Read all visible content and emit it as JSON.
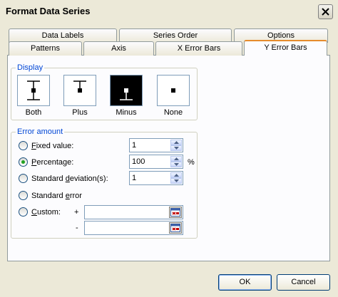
{
  "window": {
    "title": "Format Data Series"
  },
  "tabs": {
    "row_back": [
      "Data Labels",
      "Series Order",
      "Options"
    ],
    "row_front": [
      "Patterns",
      "Axis",
      "X Error Bars",
      "Y Error Bars"
    ],
    "active": "Y Error Bars"
  },
  "display": {
    "legend": "Display",
    "options": [
      {
        "label": "Both",
        "icon": "error-bar-both-icon",
        "selected": false
      },
      {
        "label": "Plus",
        "icon": "error-bar-plus-icon",
        "selected": false
      },
      {
        "label": "Minus",
        "icon": "error-bar-minus-icon",
        "selected": true
      },
      {
        "label": "None",
        "icon": "error-bar-none-icon",
        "selected": false
      }
    ]
  },
  "error_amount": {
    "legend": "Error amount",
    "fixed_value": {
      "label_key": "F",
      "label_rest": "ixed value:",
      "value": "1",
      "checked": false
    },
    "percentage": {
      "label_key": "P",
      "label_rest": "ercentage:",
      "value": "100",
      "unit": "%",
      "checked": true
    },
    "std_dev": {
      "label_pre": "Standard ",
      "label_key": "d",
      "label_rest": "eviation(s):",
      "value": "1",
      "checked": false
    },
    "std_error": {
      "label_pre": "Standard ",
      "label_key": "e",
      "label_rest": "rror",
      "checked": false
    },
    "custom": {
      "label_key": "C",
      "label_rest": "ustom:",
      "checked": false,
      "plus_sign": "+",
      "minus_sign": "-",
      "plus_value": "",
      "minus_value": ""
    }
  },
  "buttons": {
    "ok": "OK",
    "cancel": "Cancel"
  },
  "colors": {
    "group_legend": "#0046d5",
    "active_tab_accent": "#e68b2c",
    "radio_dot": "#21a121"
  }
}
